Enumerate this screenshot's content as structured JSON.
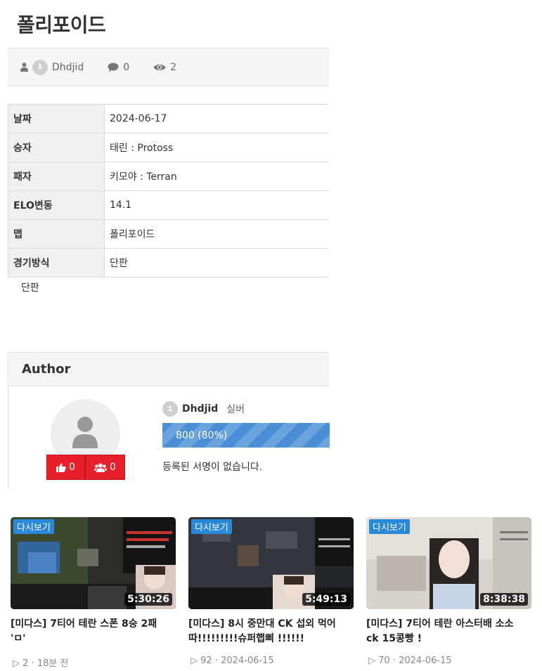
{
  "post": {
    "title": "폴리포이드",
    "author": {
      "level": "1",
      "name": "Dhdjid"
    },
    "comments": "0",
    "views": "2",
    "body": "단판"
  },
  "info_table": [
    {
      "key": "날짜",
      "value": "2024-06-17"
    },
    {
      "key": "승자",
      "value": "태린 : Protoss"
    },
    {
      "key": "패자",
      "value": "키모야 : Terran"
    },
    {
      "key": "ELO변동",
      "value": "14.1"
    },
    {
      "key": "맵",
      "value": "폴리포이드"
    },
    {
      "key": "경기방식",
      "value": "단판"
    }
  ],
  "author_box": {
    "heading": "Author",
    "level": "1",
    "name": "Dhdjid",
    "grade": "실버",
    "xp_text": "800 (80%)",
    "xp_percent": 100,
    "likes": "0",
    "friends": "0",
    "signature": "등록된 서명이 없습니다."
  },
  "videos": [
    {
      "badge": "다시보기",
      "duration": "5:30:26",
      "title": "[미다스] 7티어 테란 스폰 8승 2패 'ㅁ'",
      "plays": "2",
      "date": "18분 전"
    },
    {
      "badge": "다시보기",
      "duration": "5:49:13",
      "title": "[미다스] 8시 중만대 CK 섭외 먹어따!!!!!!!!!슈퍼햅삐 !!!!!!",
      "plays": "92",
      "date": "2024-06-15"
    },
    {
      "badge": "다시보기",
      "duration": "8:38:38",
      "title": "[미다스] 7티어 테란 아스터배 소소 ck 15콩빵 !",
      "plays": "70",
      "date": "2024-06-15"
    }
  ],
  "colors": {
    "accent_blue": "#4a8fd6",
    "like_red": "#e8202a",
    "badge_blue": "#2a88d8"
  },
  "icons": {
    "author": "user-icon",
    "comments": "comment-icon",
    "views": "eye-icon",
    "likes": "thumbs-up-icon",
    "friends": "users-icon",
    "play": "play-icon"
  }
}
